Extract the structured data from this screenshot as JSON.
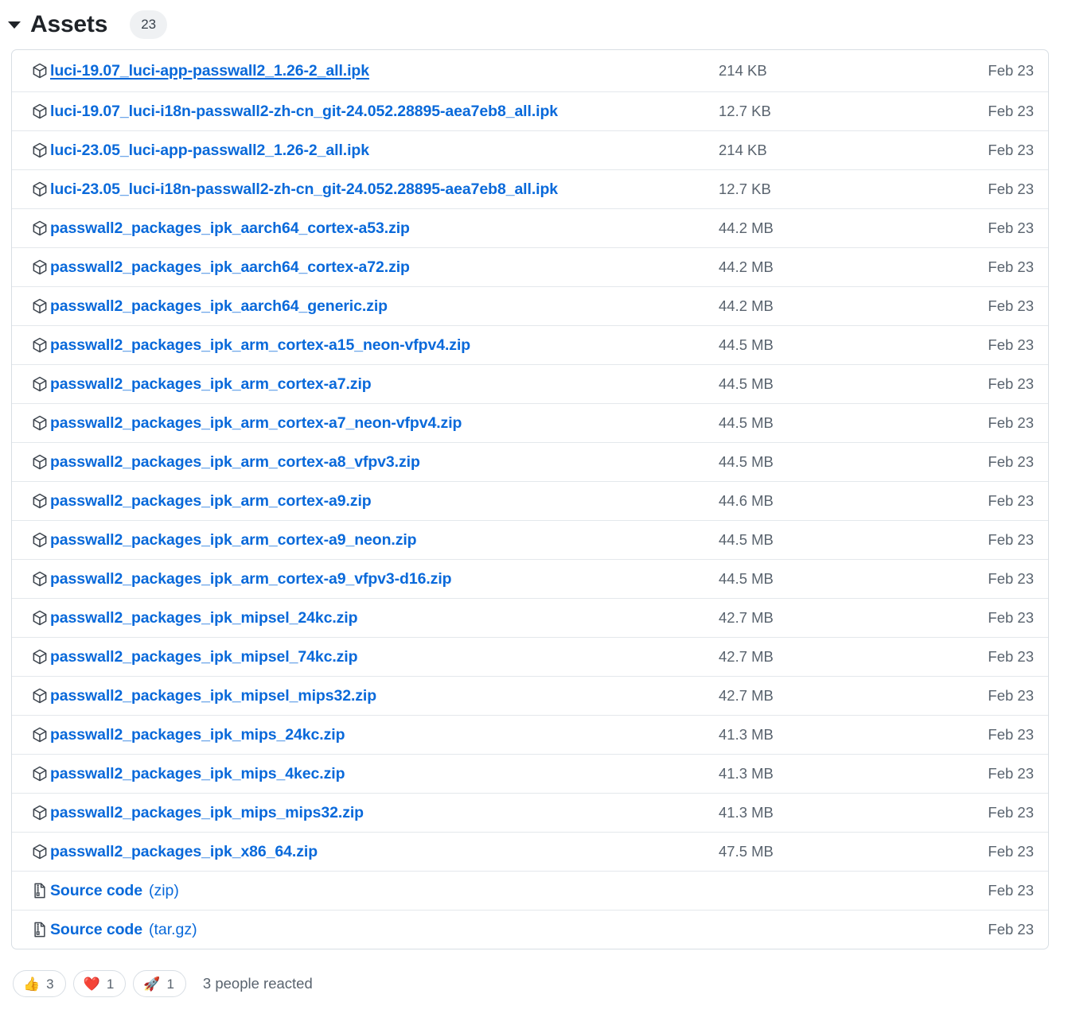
{
  "header": {
    "title": "Assets",
    "count": "23",
    "disclosure_icon": "caret-down-icon",
    "expanded": true
  },
  "table": {
    "icons": {
      "package": "package-icon",
      "source": "file-zip-icon"
    },
    "rows": [
      {
        "icon": "package-icon",
        "name": "luci-19.07_luci-app-passwall2_1.26-2_all.ipk",
        "suffix": "",
        "size": "214 KB",
        "date": "Feb 23",
        "hovered": true
      },
      {
        "icon": "package-icon",
        "name": "luci-19.07_luci-i18n-passwall2-zh-cn_git-24.052.28895-aea7eb8_all.ipk",
        "suffix": "",
        "size": "12.7 KB",
        "date": "Feb 23",
        "hovered": false
      },
      {
        "icon": "package-icon",
        "name": "luci-23.05_luci-app-passwall2_1.26-2_all.ipk",
        "suffix": "",
        "size": "214 KB",
        "date": "Feb 23",
        "hovered": false
      },
      {
        "icon": "package-icon",
        "name": "luci-23.05_luci-i18n-passwall2-zh-cn_git-24.052.28895-aea7eb8_all.ipk",
        "suffix": "",
        "size": "12.7 KB",
        "date": "Feb 23",
        "hovered": false
      },
      {
        "icon": "package-icon",
        "name": "passwall2_packages_ipk_aarch64_cortex-a53.zip",
        "suffix": "",
        "size": "44.2 MB",
        "date": "Feb 23",
        "hovered": false
      },
      {
        "icon": "package-icon",
        "name": "passwall2_packages_ipk_aarch64_cortex-a72.zip",
        "suffix": "",
        "size": "44.2 MB",
        "date": "Feb 23",
        "hovered": false
      },
      {
        "icon": "package-icon",
        "name": "passwall2_packages_ipk_aarch64_generic.zip",
        "suffix": "",
        "size": "44.2 MB",
        "date": "Feb 23",
        "hovered": false
      },
      {
        "icon": "package-icon",
        "name": "passwall2_packages_ipk_arm_cortex-a15_neon-vfpv4.zip",
        "suffix": "",
        "size": "44.5 MB",
        "date": "Feb 23",
        "hovered": false
      },
      {
        "icon": "package-icon",
        "name": "passwall2_packages_ipk_arm_cortex-a7.zip",
        "suffix": "",
        "size": "44.5 MB",
        "date": "Feb 23",
        "hovered": false
      },
      {
        "icon": "package-icon",
        "name": "passwall2_packages_ipk_arm_cortex-a7_neon-vfpv4.zip",
        "suffix": "",
        "size": "44.5 MB",
        "date": "Feb 23",
        "hovered": false
      },
      {
        "icon": "package-icon",
        "name": "passwall2_packages_ipk_arm_cortex-a8_vfpv3.zip",
        "suffix": "",
        "size": "44.5 MB",
        "date": "Feb 23",
        "hovered": false
      },
      {
        "icon": "package-icon",
        "name": "passwall2_packages_ipk_arm_cortex-a9.zip",
        "suffix": "",
        "size": "44.6 MB",
        "date": "Feb 23",
        "hovered": false
      },
      {
        "icon": "package-icon",
        "name": "passwall2_packages_ipk_arm_cortex-a9_neon.zip",
        "suffix": "",
        "size": "44.5 MB",
        "date": "Feb 23",
        "hovered": false
      },
      {
        "icon": "package-icon",
        "name": "passwall2_packages_ipk_arm_cortex-a9_vfpv3-d16.zip",
        "suffix": "",
        "size": "44.5 MB",
        "date": "Feb 23",
        "hovered": false
      },
      {
        "icon": "package-icon",
        "name": "passwall2_packages_ipk_mipsel_24kc.zip",
        "suffix": "",
        "size": "42.7 MB",
        "date": "Feb 23",
        "hovered": false
      },
      {
        "icon": "package-icon",
        "name": "passwall2_packages_ipk_mipsel_74kc.zip",
        "suffix": "",
        "size": "42.7 MB",
        "date": "Feb 23",
        "hovered": false
      },
      {
        "icon": "package-icon",
        "name": "passwall2_packages_ipk_mipsel_mips32.zip",
        "suffix": "",
        "size": "42.7 MB",
        "date": "Feb 23",
        "hovered": false
      },
      {
        "icon": "package-icon",
        "name": "passwall2_packages_ipk_mips_24kc.zip",
        "suffix": "",
        "size": "41.3 MB",
        "date": "Feb 23",
        "hovered": false
      },
      {
        "icon": "package-icon",
        "name": "passwall2_packages_ipk_mips_4kec.zip",
        "suffix": "",
        "size": "41.3 MB",
        "date": "Feb 23",
        "hovered": false
      },
      {
        "icon": "package-icon",
        "name": "passwall2_packages_ipk_mips_mips32.zip",
        "suffix": "",
        "size": "41.3 MB",
        "date": "Feb 23",
        "hovered": false
      },
      {
        "icon": "package-icon",
        "name": "passwall2_packages_ipk_x86_64.zip",
        "suffix": "",
        "size": "47.5 MB",
        "date": "Feb 23",
        "hovered": false
      },
      {
        "icon": "file-zip-icon",
        "name": "Source code",
        "suffix": "(zip)",
        "size": "",
        "date": "Feb 23",
        "hovered": false
      },
      {
        "icon": "file-zip-icon",
        "name": "Source code",
        "suffix": "(tar.gz)",
        "size": "",
        "date": "Feb 23",
        "hovered": false
      }
    ]
  },
  "reactions": {
    "items": [
      {
        "emoji": "👍",
        "icon": "thumbs-up-emoji",
        "count": "3"
      },
      {
        "emoji": "❤️",
        "icon": "heart-emoji",
        "count": "1"
      },
      {
        "emoji": "🚀",
        "icon": "rocket-emoji",
        "count": "1"
      }
    ],
    "summary": "3 people reacted"
  },
  "colors": {
    "link": "#0969da",
    "text": "#1f2328",
    "muted": "#59636e",
    "border": "#d8dee4",
    "row_border": "#e4e8ec",
    "badge_bg": "#eff1f3"
  }
}
